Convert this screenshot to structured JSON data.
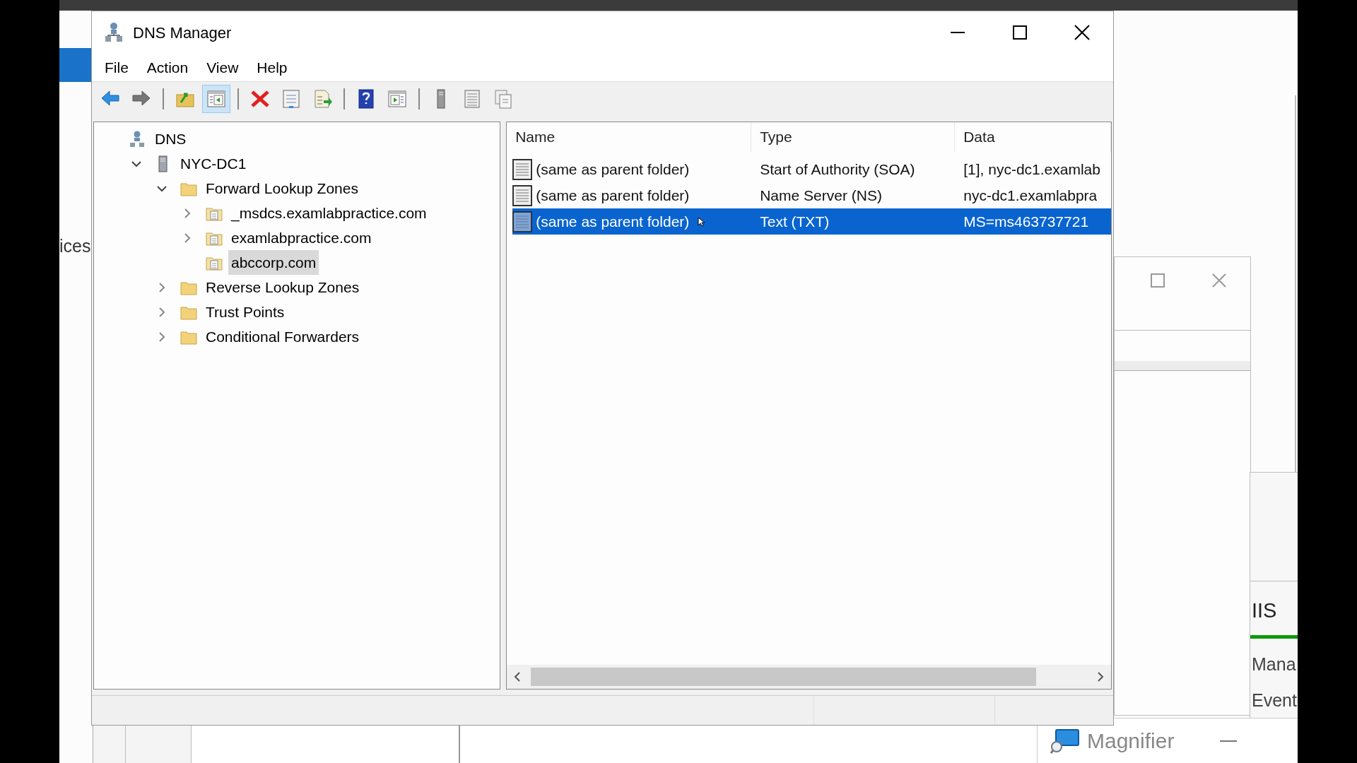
{
  "background": {
    "side_label": "ices",
    "iis_panel": {
      "title": "IIS",
      "items": [
        "Mana",
        "Event"
      ]
    },
    "magnifier": {
      "title": "Magnifier"
    }
  },
  "window": {
    "title": "DNS Manager"
  },
  "menu": [
    "File",
    "Action",
    "View",
    "Help"
  ],
  "toolbar": [
    {
      "kind": "back",
      "pressed": false
    },
    {
      "kind": "forward",
      "pressed": false
    },
    {
      "kind": "sep"
    },
    {
      "kind": "up",
      "pressed": false
    },
    {
      "kind": "tree",
      "pressed": true
    },
    {
      "kind": "sep"
    },
    {
      "kind": "delete",
      "pressed": false
    },
    {
      "kind": "properties",
      "pressed": false
    },
    {
      "kind": "export",
      "pressed": false
    },
    {
      "kind": "sep"
    },
    {
      "kind": "help",
      "pressed": false
    },
    {
      "kind": "action",
      "pressed": false
    },
    {
      "kind": "sep"
    },
    {
      "kind": "server",
      "pressed": false
    },
    {
      "kind": "list",
      "pressed": false
    },
    {
      "kind": "copy",
      "pressed": false
    }
  ],
  "tree": [
    {
      "label": "DNS",
      "kind": "dns",
      "selected": false,
      "children": [
        {
          "label": "NYC-DC1",
          "kind": "server",
          "expanded": true,
          "selected": false,
          "children": [
            {
              "label": "Forward Lookup Zones",
              "kind": "folder",
              "expanded": true,
              "selected": false,
              "children": [
                {
                  "label": "_msdcs.examlabpractice.com",
                  "kind": "zone",
                  "expanded": false,
                  "selected": false
                },
                {
                  "label": "examlabpractice.com",
                  "kind": "zone",
                  "expanded": false,
                  "selected": false
                },
                {
                  "label": "abccorp.com",
                  "kind": "zone",
                  "selected": true
                }
              ]
            },
            {
              "label": "Reverse Lookup Zones",
              "kind": "folder",
              "expanded": false,
              "selected": false
            },
            {
              "label": "Trust Points",
              "kind": "folder",
              "expanded": false,
              "selected": false
            },
            {
              "label": "Conditional Forwarders",
              "kind": "folder",
              "expanded": false,
              "selected": false
            }
          ]
        }
      ]
    }
  ],
  "list": {
    "columns": [
      "Name",
      "Type",
      "Data"
    ],
    "rows": [
      {
        "name": "(same as parent folder)",
        "type": "Start of Authority (SOA)",
        "data": "[1], nyc-dc1.examlab",
        "selected": false
      },
      {
        "name": "(same as parent folder)",
        "type": "Name Server (NS)",
        "data": "nyc-dc1.examlabpra",
        "selected": false
      },
      {
        "name": "(same as parent folder)",
        "type": "Text (TXT)",
        "data": "MS=ms463737721",
        "selected": true
      }
    ]
  }
}
